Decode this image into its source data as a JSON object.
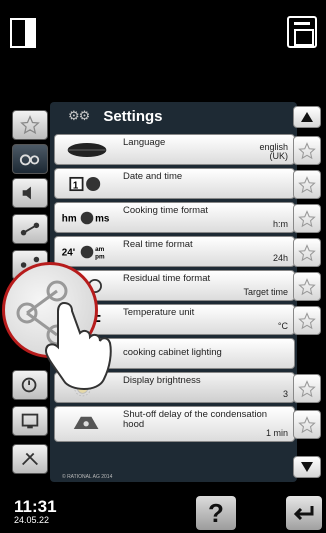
{
  "header": {
    "left_icon": "door-icon",
    "right_icon": "exit-icon"
  },
  "panel": {
    "title": "Settings",
    "title_icon": "gear-icon"
  },
  "settings": [
    {
      "label": "Language",
      "value": "english\n(UK)",
      "icon": "lips-icon",
      "favorite": true
    },
    {
      "label": "Date and time",
      "value": "",
      "icon": "calendar-clock-icon",
      "favorite": true
    },
    {
      "label": "Cooking time format",
      "value": "h:m",
      "icon": "hm-ms-icon",
      "favorite": true
    },
    {
      "label": "Real time format",
      "value": "24h",
      "icon": "24-ampm-icon",
      "favorite": true
    },
    {
      "label": "Residual time format",
      "value": "Target time",
      "icon": "residual-clock-icon",
      "favorite": true
    },
    {
      "label": "Temperature unit",
      "value": "°C",
      "icon": "fahrenheit-icon",
      "favorite": true
    },
    {
      "label": "cooking cabinet lighting",
      "value": "",
      "icon": "lighting-icon",
      "favorite": false
    },
    {
      "label": "Display brightness",
      "value": "3",
      "icon": "brightness-icon",
      "favorite": true
    },
    {
      "label": "Shut-off delay of the condensation hood",
      "value": "1 min",
      "icon": "hood-icon",
      "favorite": true
    }
  ],
  "tabs": [
    {
      "name": "favorites-tab",
      "icon": "star-icon"
    },
    {
      "name": "settings-tab",
      "icon": "gear-tab-icon",
      "active": true
    },
    {
      "name": "sound-tab",
      "icon": "speaker-icon"
    },
    {
      "name": "network-tab",
      "icon": "network-icon"
    },
    {
      "name": "share-tab",
      "icon": "share-icon"
    },
    {
      "name": "timer-tab",
      "icon": "timer-icon"
    },
    {
      "name": "display-tab",
      "icon": "display-icon"
    },
    {
      "name": "service-tab",
      "icon": "tools-icon"
    }
  ],
  "footer": {
    "copyright": "© RATIONAL AG 2014",
    "time": "11:31",
    "date": "24.05.22",
    "help_label": "?"
  }
}
